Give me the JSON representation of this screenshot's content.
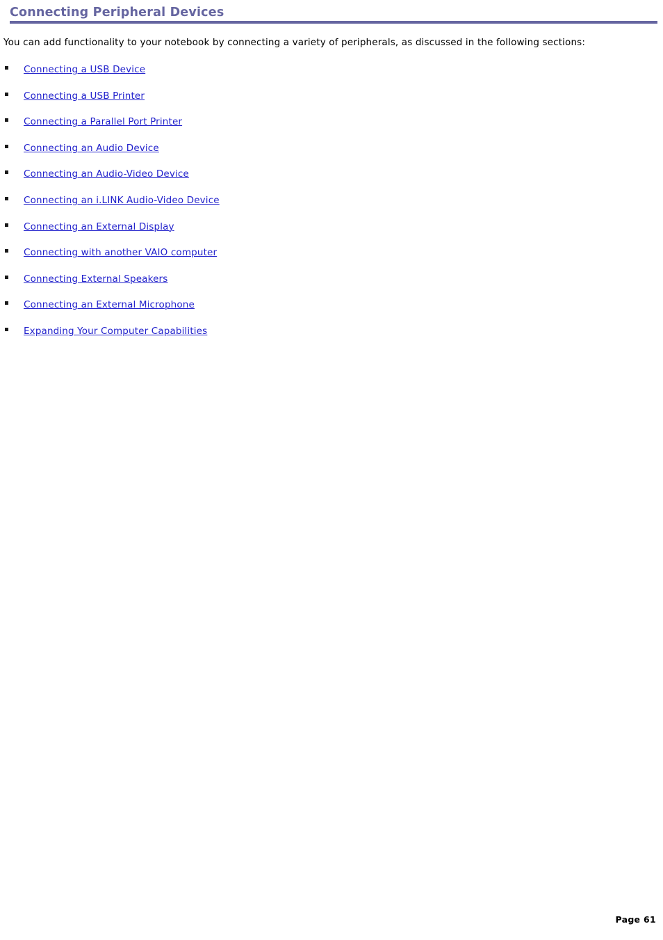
{
  "document": {
    "heading": "Connecting Peripheral Devices",
    "heading_color": "#6565a0",
    "intro": "You can add functionality to your notebook by connecting a variety of peripherals, as discussed in the following sections:",
    "link_color": "#2222cc",
    "bullet_color": "#1a1a1a",
    "background_color": "#ffffff"
  },
  "links": [
    {
      "label": "Connecting a USB Device"
    },
    {
      "label": "Connecting a USB Printer"
    },
    {
      "label": "Connecting a Parallel Port Printer"
    },
    {
      "label": "Connecting an Audio Device"
    },
    {
      "label": "Connecting an Audio-Video Device"
    },
    {
      "label": "Connecting an i.LINK Audio-Video Device"
    },
    {
      "label": "Connecting an External Display"
    },
    {
      "label": "Connecting with another VAIO computer"
    },
    {
      "label": "Connecting External Speakers"
    },
    {
      "label": "Connecting an External Microphone"
    },
    {
      "label": "Expanding Your Computer Capabilities"
    }
  ],
  "footer": {
    "page_label": "Page 61"
  }
}
